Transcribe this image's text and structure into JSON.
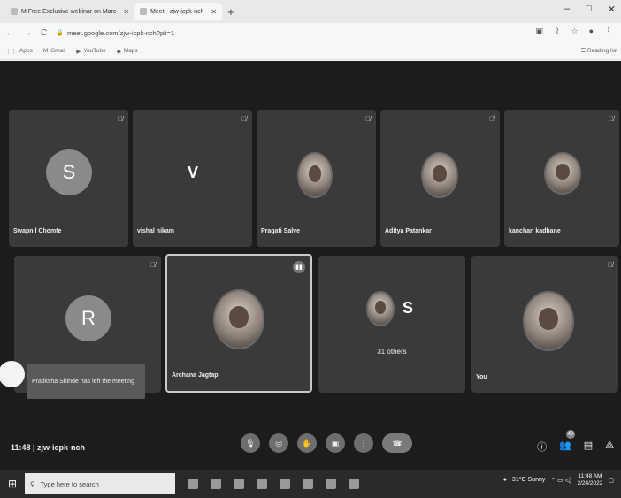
{
  "browser": {
    "tabs": [
      {
        "label": "M Free Exclusive webinar on Marc",
        "active": true
      },
      {
        "label": "Meet - zjw-icpk-nch",
        "active": false
      }
    ],
    "new_tab_glyph": "+",
    "window_controls": [
      "–",
      "□",
      "✕"
    ],
    "url": "meet.google.com/zjw-icpk-nch?pli=1",
    "bookmarks": [
      "Apps",
      "Gmail",
      "YouTube",
      "Maps"
    ],
    "reading_list": "Reading list"
  },
  "tiles_row1": [
    {
      "name": "Swapnil Chomte",
      "avatar": "S",
      "kind": "letter"
    },
    {
      "name": "vishal nikam",
      "avatar": "V",
      "kind": "plain"
    },
    {
      "name": "Pragati Salve",
      "avatar": "",
      "kind": "photo"
    },
    {
      "name": "Aditya Patankar",
      "avatar": "",
      "kind": "photo"
    },
    {
      "name": "kanchan kadbane",
      "avatar": "",
      "kind": "photo"
    }
  ],
  "tiles_row2": [
    {
      "name": "",
      "avatar": "R",
      "kind": "letter"
    },
    {
      "name": "Archana Jagtap",
      "avatar": "",
      "kind": "photo"
    },
    {
      "name": "",
      "avatar": "S",
      "kind": "others",
      "others_label": "31 others"
    },
    {
      "name": "You",
      "avatar": "",
      "kind": "photo"
    }
  ],
  "toast": {
    "text": "Pratiksha Shinde has left the meeting"
  },
  "meeting": {
    "code_label": "11:48 | zjw-icpk-nch",
    "controls": [
      "mic-off",
      "camera-off",
      "raise-hand",
      "present",
      "more",
      "end-call"
    ],
    "participant_count": "40"
  },
  "taskbar": {
    "search_placeholder": "Type here to search",
    "weather": "31°C Sunny",
    "time": "11:48 AM",
    "date": "2/24/2022"
  }
}
